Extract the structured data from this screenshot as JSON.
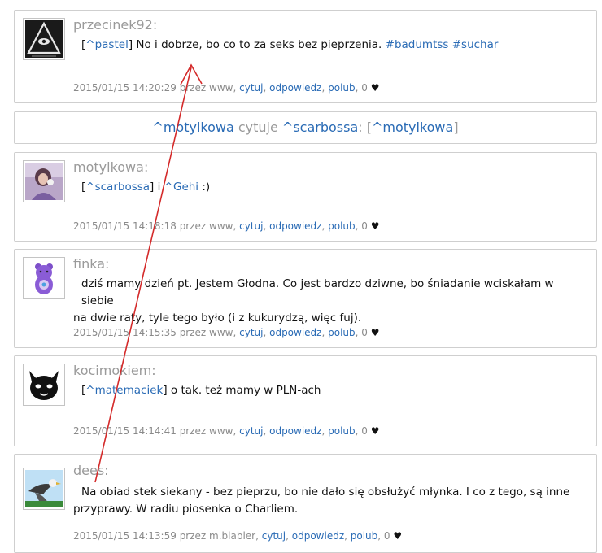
{
  "posts": [
    {
      "author": "przecinek92:",
      "body": {
        "open": "[",
        "mention": "^pastel",
        "close": "]",
        "text": " No i dobrze, bo co to za seks bez pieprzenia. ",
        "tag1": "#badumtss",
        "sp": " ",
        "tag2": "#suchar"
      },
      "meta": {
        "date": "2015/01/15 14:20:29 przez www,",
        "quote": "cytuj",
        "reply": "odpowiedz",
        "like": "polub",
        "likes": ", 0",
        "heart": "♥"
      }
    },
    {
      "author": "motylkowa:",
      "body": {
        "open": "[",
        "mention": "^scarbossa",
        "close": "]",
        "text": " i ",
        "mention2": "^Gehi",
        "text2": " :)"
      },
      "meta": {
        "date": "2015/01/15 14:18:18 przez www,",
        "quote": "cytuj",
        "reply": "odpowiedz",
        "like": "polub",
        "likes": ", 0",
        "heart": "♥"
      }
    },
    {
      "author": "finka:",
      "body": {
        "line1": "dziś mamy dzień pt. Jestem Głodna. Co jest bardzo dziwne, bo śniadanie wciskałam w siebie",
        "line2": "na dwie raty, tyle tego było (i z kukurydzą, więc fuj)."
      },
      "meta": {
        "date": "2015/01/15 14:15:35 przez www,",
        "quote": "cytuj",
        "reply": "odpowiedz",
        "like": "polub",
        "likes": ", 0",
        "heart": "♥"
      }
    },
    {
      "author": "kocimokiem:",
      "body": {
        "open": "[",
        "mention": "^matemaciek",
        "close": "]",
        "text": " o tak. też mamy w PLN-ach"
      },
      "meta": {
        "date": "2015/01/15 14:14:41 przez www,",
        "quote": "cytuj",
        "reply": "odpowiedz",
        "like": "polub",
        "likes": ", 0",
        "heart": "♥"
      }
    },
    {
      "author": "dees:",
      "body": {
        "line1": "Na obiad stek siekany - bez pieprzu, bo nie dało się obsłużyć młynka. I co z tego, są inne",
        "line2": "przyprawy. W radiu piosenka o Charliem."
      },
      "meta": {
        "date": "2015/01/15 14:13:59 przez m.blabler,",
        "quote": "cytuj",
        "reply": "odpowiedz",
        "like": "polub",
        "likes": ", 0",
        "heart": "♥"
      }
    }
  ],
  "quote_bar": {
    "user": "^motylkowa",
    "verb": " cytuje ",
    "target": "^scarbossa",
    "sep": ": [",
    "ref": "^motylkowa",
    "end": "]"
  },
  "colors": {
    "link": "#2a6bb5",
    "author": "#9a9a9a",
    "annotation": "#d42a2a"
  }
}
